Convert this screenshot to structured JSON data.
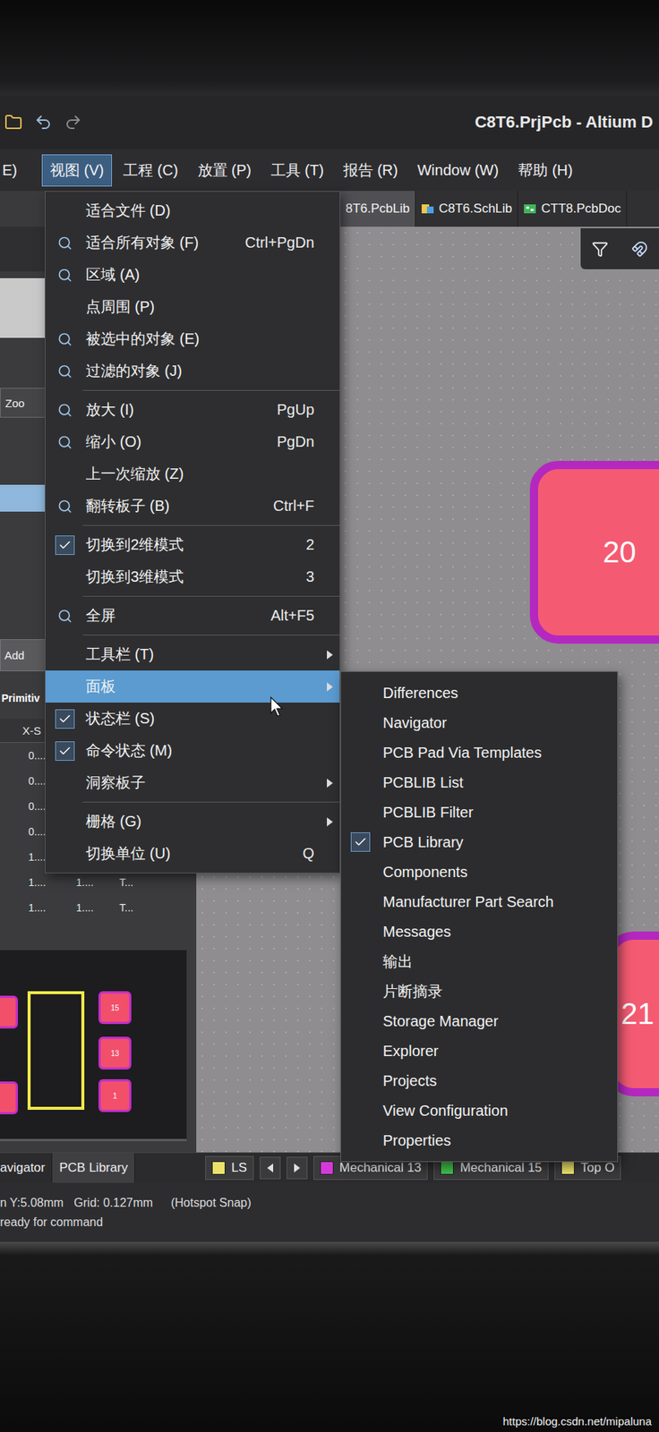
{
  "window": {
    "title": "C8T6.PrjPcb - Altium D"
  },
  "menubar": [
    {
      "label": "E)",
      "selected": false
    },
    {
      "label": "视图 (V)",
      "selected": true
    },
    {
      "label": "工程 (C)",
      "selected": false
    },
    {
      "label": "放置 (P)",
      "selected": false
    },
    {
      "label": "工具 (T)",
      "selected": false
    },
    {
      "label": "报告 (R)",
      "selected": false
    },
    {
      "label": "Window (W)",
      "selected": false
    },
    {
      "label": "帮助 (H)",
      "selected": false
    }
  ],
  "doc_tabs": [
    {
      "label": "8T6.PcbLib",
      "selected": true,
      "kind": "plain"
    },
    {
      "label": "C8T6.SchLib",
      "selected": false,
      "kind": "schlib"
    },
    {
      "label": "CTT8.PcbDoc",
      "selected": false,
      "kind": "pcbdoc"
    }
  ],
  "left_panel": {
    "zoom_label": "Zoo",
    "add_button": "Add",
    "section_title": "Primitiv",
    "column": "X-S",
    "rows": [
      [
        "0...."
      ],
      [
        "0...."
      ],
      [
        "0...."
      ],
      [
        "0...."
      ],
      [
        "1...."
      ],
      [
        "1....",
        "1....",
        "T..."
      ],
      [
        "1....",
        "1....",
        "T..."
      ]
    ],
    "preview_pads": [
      {
        "label": "",
        "kind": "edge"
      },
      {
        "label": "",
        "kind": "edge"
      },
      {
        "label": "15",
        "kind": "pad"
      },
      {
        "label": "13",
        "kind": "pad"
      },
      {
        "label": "1",
        "kind": "pad"
      }
    ]
  },
  "canvas": {
    "pads": [
      {
        "label": "20"
      },
      {
        "label": "21"
      }
    ]
  },
  "view_menu": [
    {
      "kind": "item",
      "label": "适合文件 (D)",
      "icon": false,
      "checked": false,
      "submenu": false,
      "highlighted": false
    },
    {
      "kind": "item",
      "label": "适合所有对象 (F)",
      "shortcut": "Ctrl+PgDn",
      "icon": true,
      "checked": false,
      "submenu": false,
      "highlighted": false
    },
    {
      "kind": "item",
      "label": "区域 (A)",
      "icon": true,
      "checked": false,
      "submenu": false,
      "highlighted": false
    },
    {
      "kind": "item",
      "label": "点周围 (P)",
      "icon": false,
      "checked": false,
      "submenu": false,
      "highlighted": false
    },
    {
      "kind": "item",
      "label": "被选中的对象 (E)",
      "icon": true,
      "checked": false,
      "submenu": false,
      "highlighted": false
    },
    {
      "kind": "item",
      "label": "过滤的对象 (J)",
      "icon": true,
      "checked": false,
      "submenu": false,
      "highlighted": false
    },
    {
      "kind": "separator"
    },
    {
      "kind": "item",
      "label": "放大 (I)",
      "shortcut": "PgUp",
      "icon": true,
      "checked": false,
      "submenu": false,
      "highlighted": false
    },
    {
      "kind": "item",
      "label": "缩小 (O)",
      "shortcut": "PgDn",
      "icon": true,
      "checked": false,
      "submenu": false,
      "highlighted": false
    },
    {
      "kind": "item",
      "label": "上一次缩放 (Z)",
      "icon": false,
      "checked": false,
      "submenu": false,
      "highlighted": false
    },
    {
      "kind": "item",
      "label": "翻转板子 (B)",
      "shortcut": "Ctrl+F",
      "icon": true,
      "checked": false,
      "submenu": false,
      "highlighted": false
    },
    {
      "kind": "separator"
    },
    {
      "kind": "item",
      "label": "切换到2维模式",
      "shortcut": "2",
      "icon": false,
      "checked": true,
      "submenu": false,
      "highlighted": false
    },
    {
      "kind": "item",
      "label": "切换到3维模式",
      "shortcut": "3",
      "icon": false,
      "checked": false,
      "submenu": false,
      "highlighted": false
    },
    {
      "kind": "separator"
    },
    {
      "kind": "item",
      "label": "全屏",
      "shortcut": "Alt+F5",
      "icon": true,
      "checked": false,
      "submenu": false,
      "highlighted": false
    },
    {
      "kind": "separator"
    },
    {
      "kind": "item",
      "label": "工具栏 (T)",
      "icon": false,
      "checked": false,
      "submenu": true,
      "highlighted": false
    },
    {
      "kind": "item",
      "label": "面板",
      "icon": false,
      "checked": false,
      "submenu": true,
      "highlighted": true
    },
    {
      "kind": "item",
      "label": "状态栏 (S)",
      "icon": false,
      "checked": true,
      "submenu": false,
      "highlighted": false
    },
    {
      "kind": "item",
      "label": "命令状态 (M)",
      "icon": false,
      "checked": true,
      "submenu": false,
      "highlighted": false
    },
    {
      "kind": "item",
      "label": "洞察板子",
      "icon": false,
      "checked": false,
      "submenu": true,
      "highlighted": false
    },
    {
      "kind": "separator"
    },
    {
      "kind": "item",
      "label": "栅格 (G)",
      "icon": false,
      "checked": false,
      "submenu": true,
      "highlighted": false
    },
    {
      "kind": "item",
      "label": "切换单位 (U)",
      "shortcut": "Q",
      "icon": false,
      "checked": false,
      "submenu": false,
      "highlighted": false
    }
  ],
  "panels_submenu": [
    {
      "label": "Differences",
      "checked": false
    },
    {
      "label": "Navigator",
      "checked": false
    },
    {
      "label": "PCB Pad Via Templates",
      "checked": false
    },
    {
      "label": "PCBLIB List",
      "checked": false
    },
    {
      "label": "PCBLIB Filter",
      "checked": false
    },
    {
      "label": "PCB Library",
      "checked": true
    },
    {
      "label": "Components",
      "checked": false
    },
    {
      "label": "Manufacturer Part Search",
      "checked": false
    },
    {
      "label": "Messages",
      "checked": false
    },
    {
      "label": "输出",
      "checked": false
    },
    {
      "label": "片断摘录",
      "checked": false
    },
    {
      "label": "Storage Manager",
      "checked": false
    },
    {
      "label": "Explorer",
      "checked": false
    },
    {
      "label": "Projects",
      "checked": false
    },
    {
      "label": "View Configuration",
      "checked": false
    },
    {
      "label": "Properties",
      "checked": false
    }
  ],
  "panel_tabs": [
    {
      "label": "avigator",
      "selected": false
    },
    {
      "label": "PCB Library",
      "selected": true
    }
  ],
  "layer_tabs": [
    {
      "label": "LS",
      "color": "#ece36a"
    },
    {
      "label": "Mechanical 13",
      "color": "#d33ad8"
    },
    {
      "label": "Mechanical 15",
      "color": "#3fbf4a"
    },
    {
      "label": "Top O",
      "color": "#ece36a"
    }
  ],
  "status": {
    "position": "n Y:5.08mm",
    "grid": "Grid: 0.127mm",
    "snap": "(Hotspot Snap)",
    "message": "ready for command"
  },
  "watermark": "https://blog.csdn.net/mipaluna"
}
